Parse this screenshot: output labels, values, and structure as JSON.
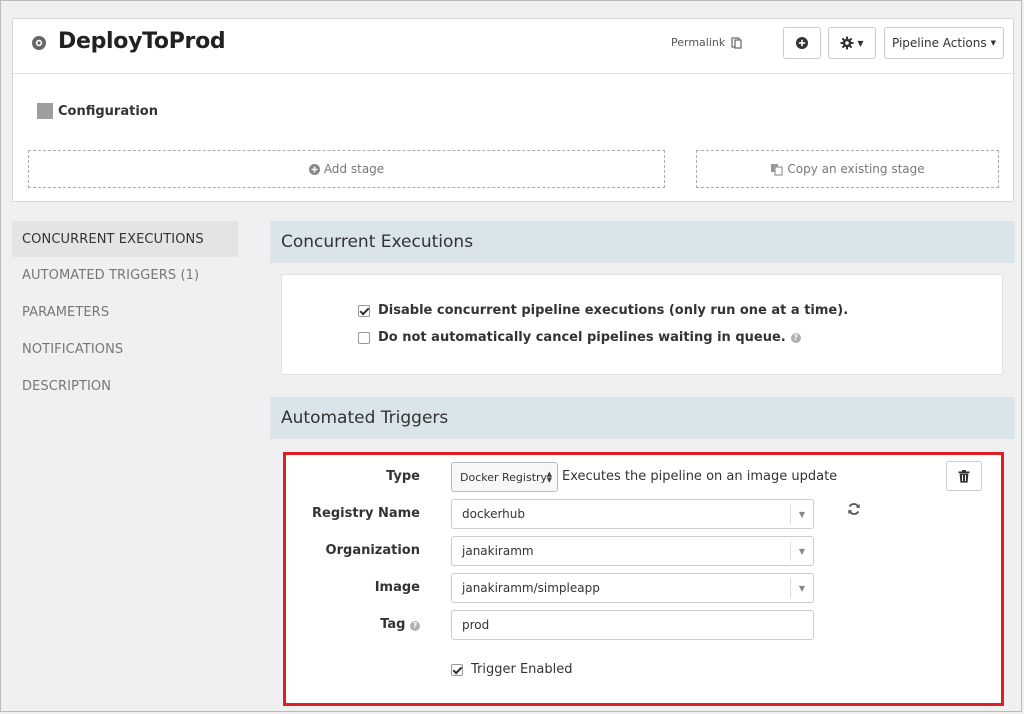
{
  "header": {
    "title": "DeployToProd",
    "permalink": "Permalink",
    "pipeline_actions": "Pipeline Actions",
    "configuration": "Configuration",
    "add_stage": "Add stage",
    "copy_stage": "Copy an existing stage"
  },
  "sidebar": {
    "items": [
      {
        "label": "CONCURRENT EXECUTIONS",
        "active": true
      },
      {
        "label": "AUTOMATED TRIGGERS (1)",
        "active": false
      },
      {
        "label": "PARAMETERS",
        "active": false
      },
      {
        "label": "NOTIFICATIONS",
        "active": false
      },
      {
        "label": "DESCRIPTION",
        "active": false
      }
    ]
  },
  "concurrent": {
    "title": "Concurrent Executions",
    "option1": {
      "label": "Disable concurrent pipeline executions (only run one at a time).",
      "checked": true
    },
    "option2": {
      "label": "Do not automatically cancel pipelines waiting in queue.",
      "checked": false
    }
  },
  "triggers": {
    "title": "Automated Triggers",
    "type_label": "Type",
    "type_value": "Docker Registry",
    "type_description": "Executes the pipeline on an image update",
    "registry_label": "Registry Name",
    "registry_value": "dockerhub",
    "organization_label": "Organization",
    "organization_value": "janakiramm",
    "image_label": "Image",
    "image_value": "janakiramm/simpleapp",
    "tag_label": "Tag",
    "tag_value": "prod",
    "enabled_label": "Trigger Enabled",
    "enabled": true
  },
  "colors": {
    "section_header_bg": "#d9e5ea",
    "highlight_border": "#e01e24",
    "active_nav_bg": "#e4e4e4"
  }
}
